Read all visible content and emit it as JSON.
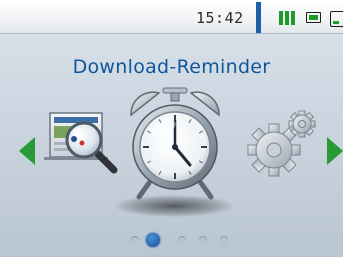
{
  "statusbar": {
    "time": "15:42",
    "signal_icon": "signal-strength-icon",
    "battery_icon": "battery-icon",
    "storage_icon": "storage-icon"
  },
  "screen": {
    "title": "Download-Reminder"
  },
  "carousel": {
    "items": [
      {
        "name": "search-tile",
        "icon": "magnifier-icon"
      },
      {
        "name": "download-reminder-tile",
        "icon": "alarm-clock-icon",
        "selected": true
      },
      {
        "name": "settings-tile",
        "icon": "gear-icon"
      }
    ],
    "page_count": 5,
    "current_page": 2
  },
  "colors": {
    "accent_blue": "#12569a",
    "arrow_green": "#2a9b34",
    "signal_green": "#1f9b2a"
  }
}
